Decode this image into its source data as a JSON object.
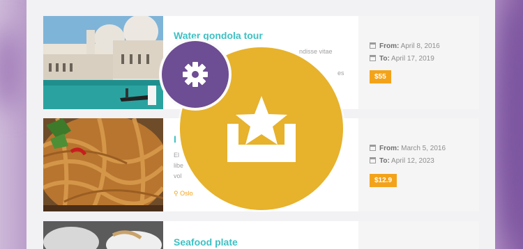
{
  "cards": [
    {
      "title": "Water gondola tour",
      "desc_lines": [
        "ndisse vitae",
        "es"
      ],
      "from_label": "From:",
      "from_value": "April 8, 2016",
      "to_label": "To:",
      "to_value": "April 17, 2019",
      "price": "$55"
    },
    {
      "title": "I",
      "desc_lines": [
        "El",
        "libe",
        "vol"
      ],
      "location": "Oslo",
      "from_label": "From:",
      "from_value": "March 5, 2016",
      "to_label": "To:",
      "to_value": "April 12, 2023",
      "price": "$12.9"
    },
    {
      "title": "Seafood plate"
    }
  ],
  "overlay": {
    "settings_icon": "gear-icon",
    "main_icon": "inbox-star-icon",
    "colors": {
      "gear_bg": "#6d4d93",
      "main_bg": "#e7b22c",
      "accent": "#3cc1c4",
      "price": "#f3a31a"
    }
  }
}
